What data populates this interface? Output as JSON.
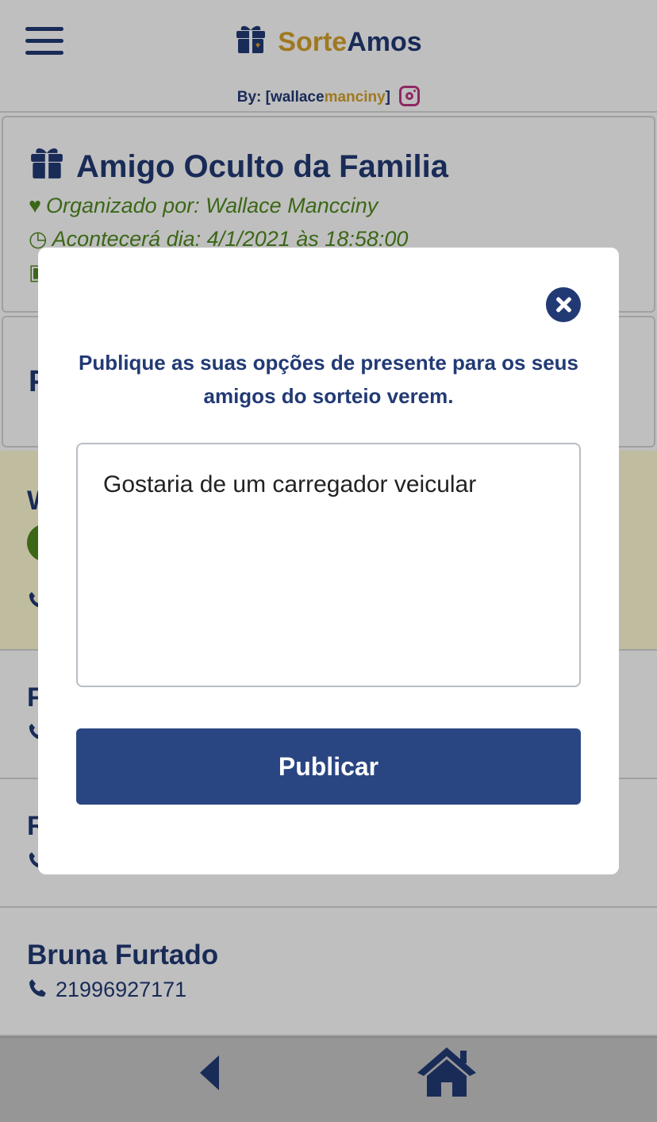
{
  "header": {
    "brand_part1": "Sorte",
    "brand_part2": "Amos",
    "byline_prefix": "By: [wallace",
    "byline_accent": "manciny",
    "byline_suffix": "]"
  },
  "event": {
    "title": "Amigo Oculto da Familia",
    "organizer": "Organizado por: Wallace Mancciny",
    "date": "Acontecerá dia: 4/1/2021 às 18:58:00"
  },
  "gift_section": {
    "partial_letter": "P"
  },
  "participants": [
    {
      "partial_letter": "W"
    },
    {
      "partial_letter": "F"
    },
    {
      "partial_letter": "R"
    },
    {
      "name": "Bruna Furtado",
      "phone": "21996927171"
    }
  ],
  "modal": {
    "message": "Publique as suas opções de presente para os seus amigos do sorteio verem.",
    "textarea_value": "Gostaria de um carregador veicular",
    "publish_label": "Publicar"
  },
  "colors": {
    "primary": "#223a74",
    "accent": "#d4a22b",
    "success": "#4f8a1f",
    "button": "#2a4682"
  },
  "icons": [
    "menu-icon",
    "gift-icon",
    "instagram-icon",
    "heart-icon",
    "clock-icon",
    "money-icon",
    "phone-icon",
    "close-icon",
    "back-icon",
    "home-icon"
  ]
}
